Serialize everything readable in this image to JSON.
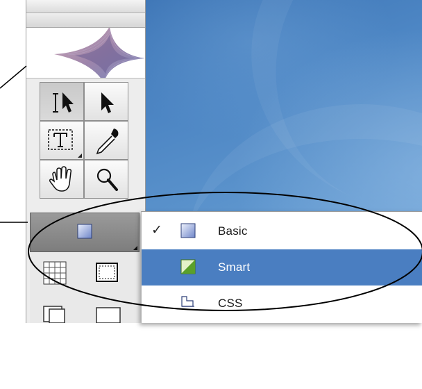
{
  "menu": {
    "items": [
      {
        "label": "Basic",
        "checked": true,
        "selected": false,
        "icon": "basic-frame-icon"
      },
      {
        "label": "Smart",
        "checked": false,
        "selected": true,
        "icon": "smart-frame-icon"
      },
      {
        "label": "CSS",
        "checked": false,
        "selected": false,
        "icon": "css-frame-icon"
      }
    ],
    "check_mark": "✓"
  },
  "tools": [
    {
      "name": "text-select-tool",
      "icon": "text-cursor-arrow-icon"
    },
    {
      "name": "arrow-select-tool",
      "icon": "arrow-icon"
    },
    {
      "name": "text-frame-tool",
      "icon": "text-frame-icon"
    },
    {
      "name": "eyedropper-tool",
      "icon": "eyedropper-icon"
    },
    {
      "name": "hand-tool",
      "icon": "hand-icon"
    },
    {
      "name": "zoom-tool",
      "icon": "magnifier-icon"
    }
  ],
  "colors": {
    "selection": "#4a7ec1",
    "desktop": "#4d86c4",
    "annotation": "#000000"
  }
}
